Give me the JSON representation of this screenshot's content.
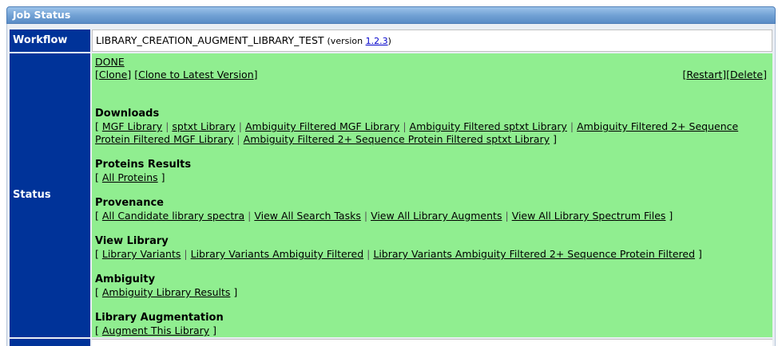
{
  "panel_title": "Job Status",
  "workflow": {
    "label": "Workflow",
    "name": "LIBRARY_CREATION_AUGMENT_LIBRARY_TEST",
    "version_prefix": "(version ",
    "version": "1.2.3",
    "version_suffix": ")"
  },
  "status": {
    "label": "Status",
    "state": "DONE",
    "clone": "Clone",
    "clone_latest": "Clone to Latest Version",
    "restart": "Restart",
    "delete": "Delete"
  },
  "sections": {
    "downloads": {
      "title": "Downloads",
      "links": [
        "MGF Library",
        "sptxt Library",
        "Ambiguity Filtered MGF Library",
        "Ambiguity Filtered sptxt Library",
        "Ambiguity Filtered 2+ Sequence Protein Filtered MGF Library",
        "Ambiguity Filtered 2+ Sequence Protein Filtered sptxt Library"
      ]
    },
    "proteins": {
      "title": "Proteins Results",
      "links": [
        "All Proteins"
      ]
    },
    "provenance": {
      "title": "Provenance",
      "links": [
        "All Candidate library spectra",
        "View All Search Tasks",
        "View All Library Augments",
        "View All Library Spectrum Files"
      ]
    },
    "view_library": {
      "title": "View Library",
      "links": [
        "Library Variants",
        "Library Variants Ambiguity Filtered",
        "Library Variants Ambiguity Filtered 2+ Sequence Protein Filtered"
      ]
    },
    "ambiguity": {
      "title": "Ambiguity",
      "links": [
        "Ambiguity Library Results"
      ]
    },
    "augmentation": {
      "title": "Library Augmentation",
      "links": [
        "Augment This Library"
      ]
    }
  },
  "colors": {
    "header_blue": "#003399",
    "status_green": "#90ee90",
    "title_bar": "#6f9fd3"
  }
}
